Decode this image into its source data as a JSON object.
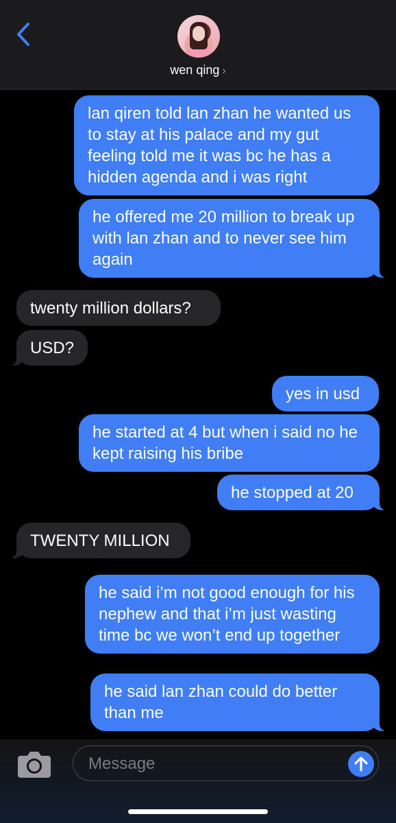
{
  "header": {
    "contact_name": "wen qing",
    "chevron": "›",
    "back_icon": "chevron-left-icon",
    "accent_color": "#3f7ef4"
  },
  "messages": [
    {
      "side": "out",
      "text": "lan qiren told lan zhan he wanted us to stay at his palace and my gut feeling told me it was bc he has a hidden agenda and i was right"
    },
    {
      "side": "out",
      "text": "he offered me 20 million to break up with lan zhan and to never see him again"
    },
    {
      "side": "in",
      "text": "twenty million dollars?"
    },
    {
      "side": "in",
      "text": "USD?"
    },
    {
      "side": "out",
      "text": "yes in usd"
    },
    {
      "side": "out",
      "text": "he started at 4 but when i said no he kept raising his bribe"
    },
    {
      "side": "out",
      "text": "he stopped at 20"
    },
    {
      "side": "in",
      "text": "TWENTY MILLION"
    },
    {
      "side": "out",
      "text": "he said i’m not good enough for his nephew and that i’m just wasting time bc we won’t end up together"
    },
    {
      "side": "out",
      "text": "he said lan zhan could do better than me"
    }
  ],
  "composer": {
    "placeholder": "Message",
    "camera_icon": "camera-icon",
    "send_icon": "arrow-up-icon"
  }
}
